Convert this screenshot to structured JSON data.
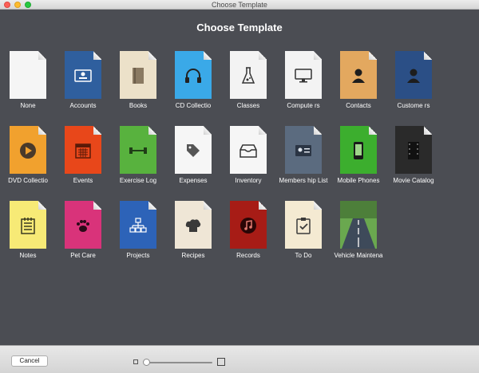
{
  "window": {
    "title": "Choose Template"
  },
  "heading": "Choose Template",
  "templates": [
    {
      "label": "None",
      "icon": "blank-doc-icon",
      "color": "#f5f5f5"
    },
    {
      "label": "Accounts",
      "icon": "id-card-icon",
      "color": "#2f5f9e"
    },
    {
      "label": "Books",
      "icon": "book-icon",
      "color": "#ece1c9"
    },
    {
      "label": "CD Collectio",
      "icon": "headphones-icon",
      "color": "#3aa9e8"
    },
    {
      "label": "Classes",
      "icon": "flask-icon",
      "color": "#f3f3f3"
    },
    {
      "label": "Compute rs",
      "icon": "monitor-icon",
      "color": "#f3f3f3"
    },
    {
      "label": "Contacts",
      "icon": "person-icon",
      "color": "#e3a85f"
    },
    {
      "label": "Custome rs",
      "icon": "person-icon",
      "color": "#2b4f86"
    },
    {
      "label": "DVD Collectio",
      "icon": "play-icon",
      "color": "#f1a12e"
    },
    {
      "label": "Events",
      "icon": "calendar-icon",
      "color": "#e8471a"
    },
    {
      "label": "Exercise Log",
      "icon": "dumbbell-icon",
      "color": "#58b23e"
    },
    {
      "label": "Expenses",
      "icon": "tag-icon",
      "color": "#f6f6f6"
    },
    {
      "label": "Inventory",
      "icon": "tray-icon",
      "color": "#f6f6f6"
    },
    {
      "label": "Members hip List",
      "icon": "member-card-icon",
      "color": "#5b6b7f"
    },
    {
      "label": "Mobile Phones",
      "icon": "phone-icon",
      "color": "#3cae2e"
    },
    {
      "label": "Movie Catalog",
      "icon": "film-icon",
      "color": "#2a2a2a"
    },
    {
      "label": "Notes",
      "icon": "notepad-icon",
      "color": "#f7ea76"
    },
    {
      "label": "Pet Care",
      "icon": "paw-icon",
      "color": "#d9337a"
    },
    {
      "label": "Projects",
      "icon": "org-chart-icon",
      "color": "#2d63b8"
    },
    {
      "label": "Recipes",
      "icon": "chef-hat-icon",
      "color": "#efe6d6"
    },
    {
      "label": "Records",
      "icon": "music-note-icon",
      "color": "#a71c16"
    },
    {
      "label": "To Do",
      "icon": "checklist-icon",
      "color": "#f4ead2"
    },
    {
      "label": "Vehicle Maintena",
      "icon": "road-icon",
      "color": "#5f9a4a"
    }
  ],
  "footer": {
    "cancel_label": "Cancel"
  },
  "zoom_slider": {
    "value": 0
  }
}
